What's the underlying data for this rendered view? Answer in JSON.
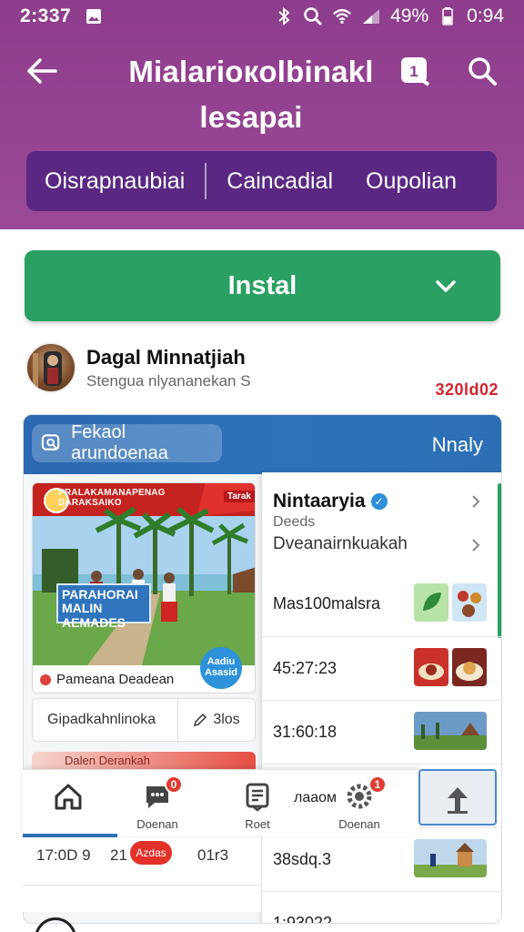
{
  "status_bar": {
    "time": "2:337",
    "battery": "49%",
    "clock": "0:94"
  },
  "header": {
    "title": "Mialarioкolbinakl lesapai",
    "tabs": [
      "Oisrapnaubiai",
      "Caincadial",
      "Oupolian"
    ]
  },
  "install": {
    "label": "Instal"
  },
  "developer": {
    "name": "Dagal Minnatjiah",
    "subtitle": "Stengua nlyananekan S",
    "code": "320ld02"
  },
  "card": {
    "search_label": "Fekaol arundoenaa",
    "right_label": "Nnaly",
    "promo": {
      "banner_text": "PRALAKAMANAPENAG DARAKSAIKO",
      "badge_text": "Tarak",
      "sign_text": "PARAHORAI MALIN AEMADES",
      "circle_text": "Aadiu Asasid",
      "caption": "Pameana Deadean"
    },
    "buttons": {
      "primary": "Gipadkahnlinoka",
      "secondary": "3los"
    },
    "strip_label": "Dalen Derankah",
    "list": {
      "title": "Nintaaryia",
      "sub1": "Deeds",
      "sub2": "Dveanairnkuakah",
      "rows": [
        {
          "label": "Mas100malsra"
        },
        {
          "label": "45:27:23"
        },
        {
          "label": "31:60:18"
        },
        {
          "label": ""
        },
        {
          "label": "38sdq.3"
        },
        {
          "label": "1:93022"
        }
      ]
    }
  },
  "bottom_nav": {
    "items": [
      {
        "label": "",
        "icon": "home-icon",
        "badge": ""
      },
      {
        "label": "Doenan",
        "icon": "chat-icon",
        "badge": "0"
      },
      {
        "label": "Roet",
        "icon": "receipt-icon",
        "badge": ""
      },
      {
        "label": "Doenan",
        "icon": "gear-icon",
        "badge": "1"
      }
    ],
    "overlay_label": "лааом"
  },
  "bottom_row": {
    "a": "17:0D 9",
    "b": "21",
    "bubble": "Azdas",
    "c": "01r3"
  },
  "colors": {
    "header": "#8e3d8c",
    "tab_strip": "#5a2883",
    "install": "#2aa063",
    "card_top": "#2c73bc",
    "accent_red": "#d1242f"
  }
}
